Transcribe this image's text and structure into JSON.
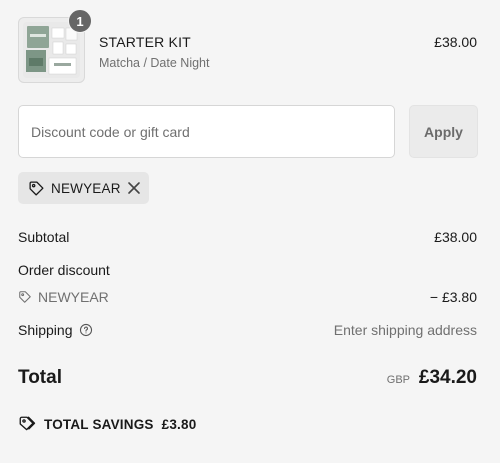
{
  "product": {
    "quantity_badge": "1",
    "name": "STARTER KIT",
    "variant": "Matcha / Date Night",
    "price": "£38.00"
  },
  "discount": {
    "input_placeholder": "Discount code or gift card",
    "input_value": "",
    "apply_label": "Apply",
    "applied_code": "NEWYEAR"
  },
  "summary": {
    "subtotal_label": "Subtotal",
    "subtotal_value": "£38.00",
    "order_discount_label": "Order discount",
    "discount_code": "NEWYEAR",
    "discount_value": "− £3.80",
    "shipping_label": "Shipping",
    "shipping_value": "Enter shipping address",
    "total_label": "Total",
    "currency": "GBP",
    "total_value": "£34.20",
    "savings_label": "TOTAL SAVINGS",
    "savings_value": "£3.80"
  },
  "icons": {
    "tag": "tag-icon",
    "close": "close-icon",
    "help": "help-circle-icon",
    "savings": "tags-icon"
  },
  "colors": {
    "background": "#f5f5f5",
    "badge": "#666666",
    "muted_text": "#707070",
    "chip_bg": "#e6e6e6"
  }
}
